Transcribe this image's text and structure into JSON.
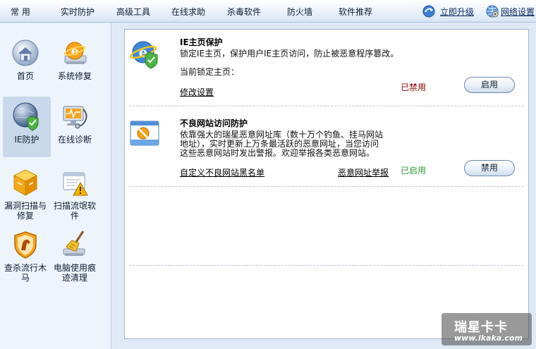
{
  "menu": {
    "items": [
      {
        "label": "常 用"
      },
      {
        "label": "实时防护"
      },
      {
        "label": "高级工具"
      },
      {
        "label": "在线求助"
      },
      {
        "label": "杀毒软件"
      },
      {
        "label": "防火墙"
      },
      {
        "label": "软件推荐"
      }
    ],
    "upgrade_label": "立即升级",
    "network_label": "网络设置"
  },
  "sidebar": {
    "items": [
      {
        "label": "首页",
        "icon": "home-icon"
      },
      {
        "label": "系统修复",
        "icon": "ie-repair-icon"
      },
      {
        "label": "IE防护",
        "icon": "ie-shield-icon"
      },
      {
        "label": "在线诊断",
        "icon": "online-diagnosis-icon"
      },
      {
        "label": "漏洞扫描与修复",
        "icon": "vulnerability-box-icon"
      },
      {
        "label": "扫描流氓软件",
        "icon": "rogue-software-warning-icon"
      },
      {
        "label": "查杀流行木马",
        "icon": "trojan-shield-icon"
      },
      {
        "label": "电脑使用痕迹清理",
        "icon": "broom-icon"
      }
    ]
  },
  "sections": {
    "ie_home": {
      "title": "IE主页保护",
      "desc": "锁定IE主页，保护用户IE主页访问，防止被恶意程序篡改。",
      "current_label": "当前锁定主页：",
      "link": "修改设置",
      "status": "已禁用",
      "button": "启用"
    },
    "bad_site": {
      "title": "不良网站访问防护",
      "desc_line1": "依靠强大的瑞星恶意网址库（数十万个钓鱼、挂马网站",
      "desc_line2": "地址），实时更新上万条最活跃的恶意网址，当您访问",
      "desc_line3": "这些恶意网站时发出警报。欢迎举报各类恶意网站。",
      "link_blacklist": "自定义不良网站黑名单",
      "link_report": "恶意网址举报",
      "status": "已启用",
      "button": "禁用"
    }
  },
  "watermark": {
    "brand": "瑞星卡卡",
    "url": "www.ikaka.com"
  },
  "colors": {
    "disabled": "#8b0000",
    "enabled": "#2e9a2e",
    "accent": "#2b6cc4"
  }
}
